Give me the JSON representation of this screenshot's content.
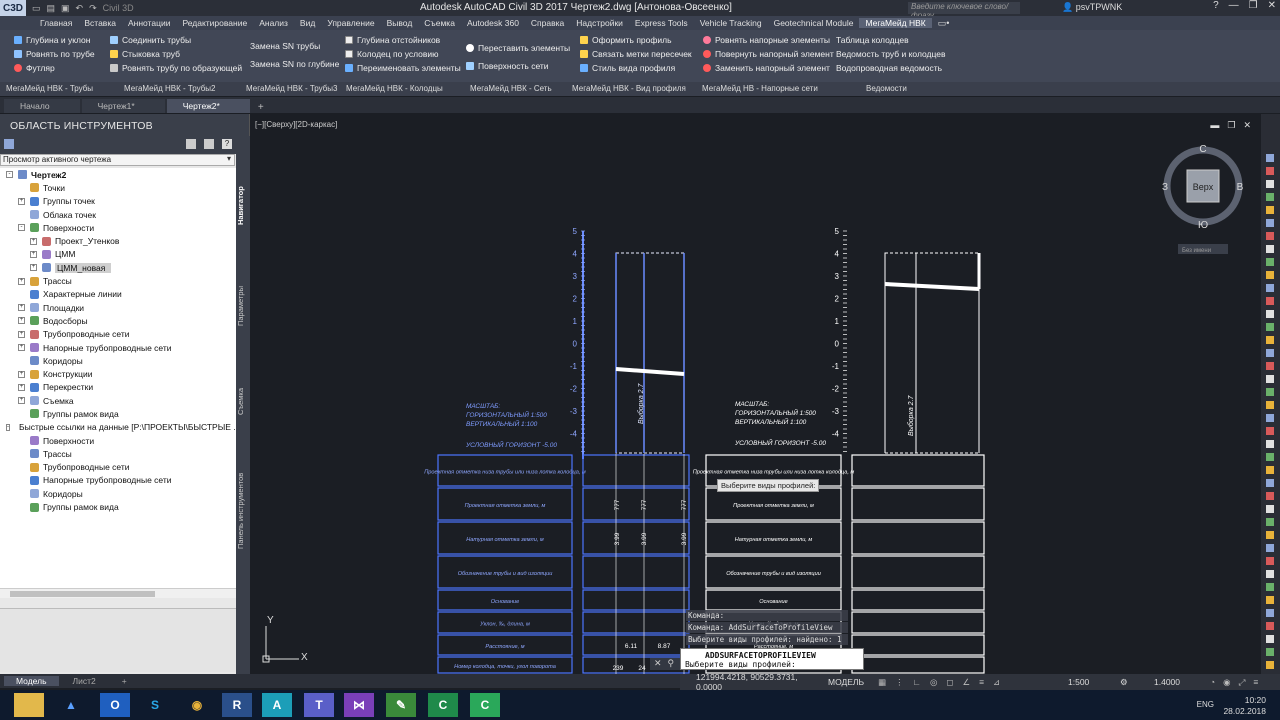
{
  "titlebar": {
    "app_letter": "C3D",
    "workspace": "Civil 3D",
    "title": "Autodesk AutoCAD Civil 3D 2017    Чертеж2.dwg [Антонова-Овсеенко]",
    "search_placeholder": "Введите ключевое слово/фразу",
    "user": "psvTPWNK"
  },
  "ribbon_tabs": [
    "Главная",
    "Вставка",
    "Аннотации",
    "Редактирование",
    "Анализ",
    "Вид",
    "Управление",
    "Вывод",
    "Съемка",
    "Autodesk 360",
    "Справка",
    "Надстройки",
    "Express Tools",
    "Vehicle Tracking",
    "Geotechnical Module",
    "МегаМейд НВК"
  ],
  "ribbon": {
    "col1": [
      "Глубина и уклон",
      "Ровнять по трубе",
      "Футляр"
    ],
    "col2": [
      "Соединить трубы",
      "Стыковка труб",
      "Ровнять трубу по образующей"
    ],
    "col3": [
      "Замена SN трубы",
      "Замена SN по глубине"
    ],
    "col4": [
      "Глубина отстойников",
      "Колодец по условию",
      "Переименовать элементы"
    ],
    "col5": [
      "Переставить элементы",
      "Поверхность сети"
    ],
    "col6": [
      "Оформить профиль",
      "Связать метки пересечек",
      "Стиль вида профиля"
    ],
    "col7": [
      "Ровнять напорные элементы",
      "Повернуть напорный элемент",
      "Заменить напорный элемент"
    ],
    "col8": [
      "Таблица колодцев",
      "Ведомость труб и колодцев",
      "Водопроводная ведомость"
    ],
    "panels": [
      "МегаМейд НВК - Трубы",
      "МегаМейд НВК - Трубы2",
      "МегаМейд НВК - Трубы3",
      "МегаМейд НВК - Колодцы",
      "МегаМейд НВК - Сеть",
      "МегаМейд НВК - Вид профиля",
      "МегаМейд НВ - Напорные сети",
      "Ведомости"
    ]
  },
  "file_tabs": [
    "Начало",
    "Чертеж1*",
    "Чертеж2*"
  ],
  "toolspace": {
    "title": "ОБЛАСТЬ ИНСТРУМЕНТОВ",
    "dropdown": "Просмотр активного чертежа",
    "vtabs": [
      "Навигатор",
      "Параметры",
      "Съемка",
      "Панель инструментов"
    ],
    "tree": [
      {
        "label": "Чертеж2",
        "level": 0,
        "exp": "-",
        "bold": true
      },
      {
        "label": "Точки",
        "level": 1,
        "exp": ""
      },
      {
        "label": "Группы точек",
        "level": 1,
        "exp": "+"
      },
      {
        "label": "Облака точек",
        "level": 1,
        "exp": ""
      },
      {
        "label": "Поверхности",
        "level": 1,
        "exp": "-"
      },
      {
        "label": "Проект_Утенков",
        "level": 2,
        "exp": "+"
      },
      {
        "label": "ЦММ",
        "level": 2,
        "exp": "+"
      },
      {
        "label": "ЦММ_новая",
        "level": 2,
        "exp": "+",
        "sel": true
      },
      {
        "label": "Трассы",
        "level": 1,
        "exp": "+"
      },
      {
        "label": "Характерные линии",
        "level": 1,
        "exp": ""
      },
      {
        "label": "Площадки",
        "level": 1,
        "exp": "+"
      },
      {
        "label": "Водосборы",
        "level": 1,
        "exp": "+"
      },
      {
        "label": "Трубопроводные сети",
        "level": 1,
        "exp": "+"
      },
      {
        "label": "Напорные трубопроводные сети",
        "level": 1,
        "exp": "+"
      },
      {
        "label": "Коридоры",
        "level": 1,
        "exp": ""
      },
      {
        "label": "Конструкции",
        "level": 1,
        "exp": "+"
      },
      {
        "label": "Перекрестки",
        "level": 1,
        "exp": "+"
      },
      {
        "label": "Съемка",
        "level": 1,
        "exp": "+"
      },
      {
        "label": "Группы рамок вида",
        "level": 1,
        "exp": ""
      },
      {
        "label": "Быстрые ссылки на данные [P:\\ПРОЕКТЫ\\БЫСТРЫЕ ...",
        "level": 0,
        "exp": "-"
      },
      {
        "label": "Поверхности",
        "level": 1,
        "exp": ""
      },
      {
        "label": "Трассы",
        "level": 1,
        "exp": ""
      },
      {
        "label": "Трубопроводные сети",
        "level": 1,
        "exp": ""
      },
      {
        "label": "Напорные трубопроводные сети",
        "level": 1,
        "exp": ""
      },
      {
        "label": "Коридоры",
        "level": 1,
        "exp": ""
      },
      {
        "label": "Группы рамок вида",
        "level": 1,
        "exp": ""
      }
    ]
  },
  "drawing": {
    "view_label": "[−][Сверху][2D-каркас]",
    "axis_ticks": [
      "5",
      "4",
      "3",
      "2",
      "1",
      "0",
      "-1",
      "-2",
      "-3",
      "-4"
    ],
    "scale_text": [
      "МАСШТАБ:",
      "ГОРИЗОНТАЛЬНЫЙ 1:500",
      "ВЕРТИКАЛЬНЫЙ 1:100"
    ],
    "horizon_text": "УСЛОВНЫЙ ГОРИЗОНТ -5.00",
    "left_rows": [
      "Проектная отметка низа трубы или низа лотка колодца, м",
      "Проектная отметка земли, м",
      "Натурная отметка земли, м",
      "Обозначение трубы и вид изоляции",
      "Основание",
      "Уклон, ‰, длина, м",
      "Расстояние, м",
      "Номер колодца, точки, угол поворота"
    ],
    "mid_values": {
      "r2": [
        "777",
        "777",
        "777"
      ],
      "r3": [
        "3.99",
        "3.99",
        "3.99"
      ],
      "r7": [
        "6.11",
        "8.87"
      ],
      "r8": [
        "239",
        "24"
      ]
    },
    "vertical_label": "Выборка 2.7",
    "tooltip": "Выберите виды профилей:"
  },
  "viewcube": {
    "top": "Верх",
    "n": "С",
    "s": "Ю",
    "e": "В",
    "w": "З",
    "wcs": "Без имени"
  },
  "ucs": {
    "x": "X",
    "y": "Y"
  },
  "command": {
    "history": [
      "Команда:",
      "Команда: AddSurfaceToProfileView",
      "Выберите виды профилей: найдено: 1"
    ],
    "current": "ADDSURFACETOPROFILEVIEW",
    "prompt": "Выберите виды профилей:"
  },
  "layout_tabs": [
    "Модель",
    "Лист2"
  ],
  "status": {
    "coords": "121994.4218, 90529.3731, 0.0000",
    "model": "МОДЕЛЬ",
    "scale": "1:500",
    "zoom": "1.4000"
  },
  "taskbar": {
    "lang": "ENG",
    "time": "10:20",
    "date": "28.02.2018"
  },
  "colors": {
    "blue_lines": "#4d74ff",
    "white_lines": "#ffffff",
    "accent": "#5a6275"
  }
}
